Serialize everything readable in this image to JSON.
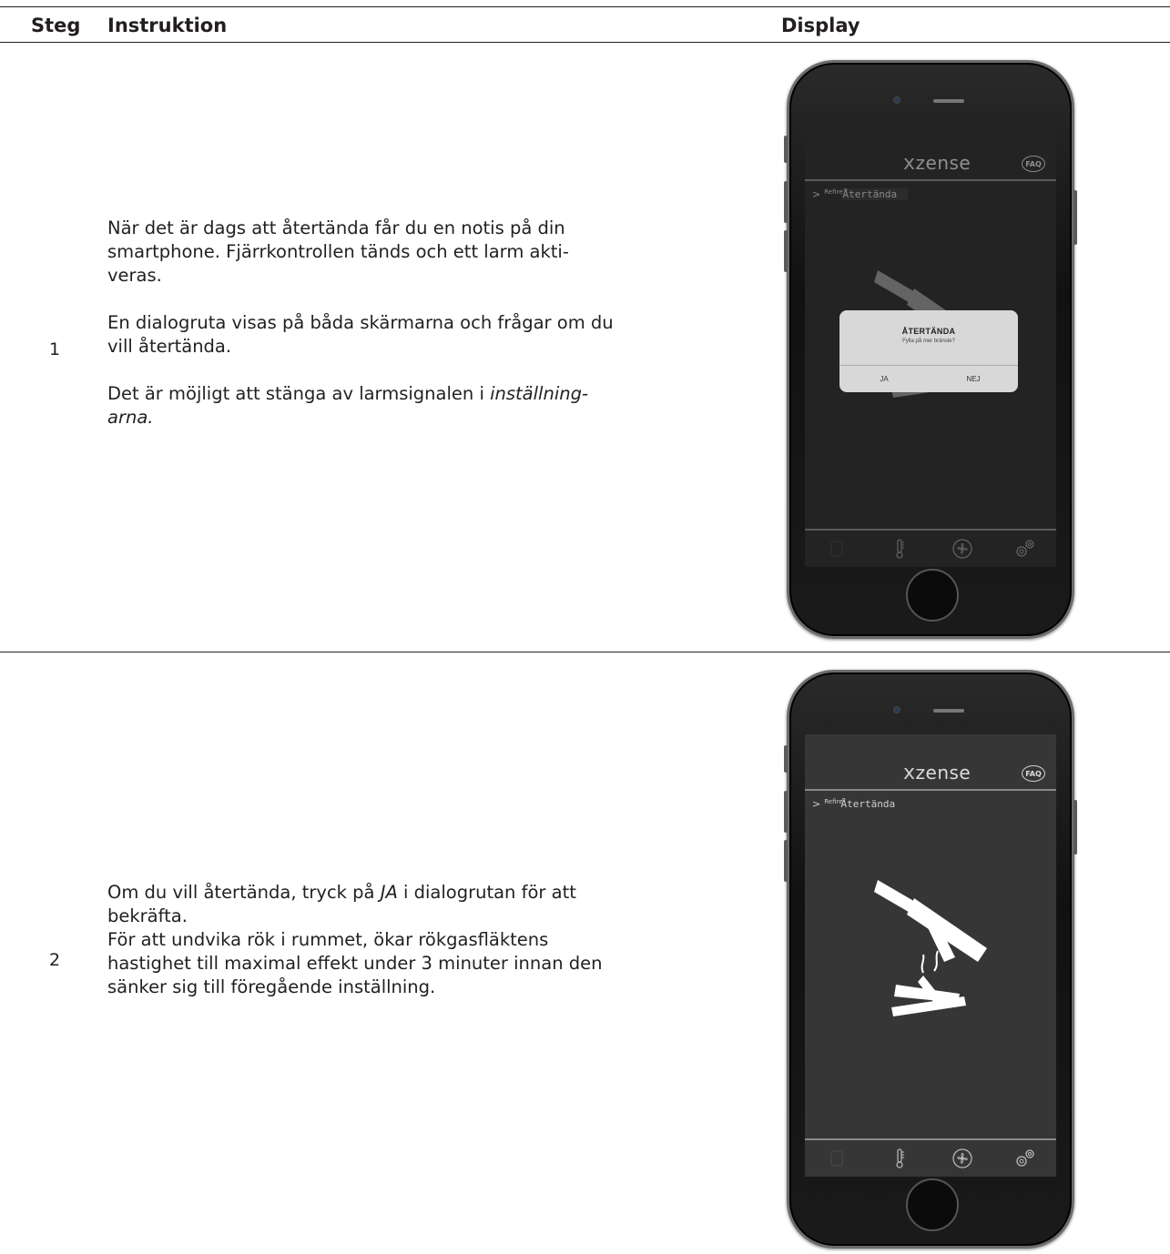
{
  "table": {
    "headers": {
      "step": "Steg",
      "instruction": "Instruktion",
      "display": "Display"
    }
  },
  "rows": [
    {
      "step": "1",
      "paragraphs": [
        "När det är dags att återtända får du en notis på din smartphone. Fjärrkontrollen tänds och ett larm akti-veras.",
        "En dialogruta visas på båda skärmarna och frågar om du vill återtända.",
        "Det är möjligt att stänga av larmsignalen i "
      ],
      "italic_suffix": "inställning-arna.",
      "phone": {
        "logo": "zense",
        "logo_prefix": "x",
        "faq": "FAQ",
        "crumb_small": "Refire",
        "crumb_main": "Återtända",
        "dialog": {
          "title": "ÅTERTÄNDA",
          "message": "Fylla på mer bränsle?",
          "yes": "JA",
          "no": "NEJ"
        }
      }
    },
    {
      "step": "2",
      "lines": [
        "Om du vill återtända, tryck på ",
        " i dialogrutan för att bekräfta.",
        "För att undvika rök i rummet, ökar rökgasfläktens hastighet till maximal effekt under 3 minuter innan den sänker sig till föregående inställning."
      ],
      "italic_word": "JA",
      "phone": {
        "logo": "zense",
        "logo_prefix": "x",
        "faq": "FAQ",
        "crumb_small": "Refire",
        "crumb_main": "Återtända"
      }
    }
  ]
}
